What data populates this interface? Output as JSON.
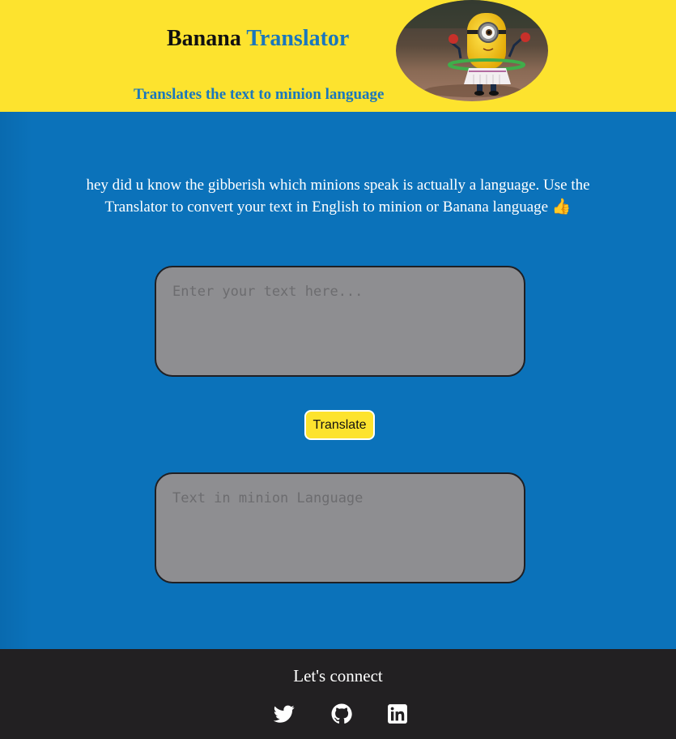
{
  "header": {
    "title_part1": "Banana",
    "title_part2": "Translator",
    "subtitle": "Translates the text to minion language"
  },
  "intro": {
    "text": "hey did u know the gibberish which minions speak is actually a language. Use the Translator to convert your text in English to minion or Banana language 👍"
  },
  "translator": {
    "input_placeholder": "Enter your text here...",
    "input_value": "",
    "button_label": "Translate",
    "output_placeholder": "Text in minion Language",
    "output_value": ""
  },
  "footer": {
    "heading": "Let's connect",
    "links": [
      {
        "icon": "twitter-icon"
      },
      {
        "icon": "github-icon"
      },
      {
        "icon": "linkedin-icon"
      }
    ]
  },
  "colors": {
    "header_bg": "#fde32e",
    "accent_blue": "#1a77bc",
    "main_bg": "#0b72ba",
    "textarea_bg": "#8e8e91",
    "footer_bg": "#222022"
  }
}
